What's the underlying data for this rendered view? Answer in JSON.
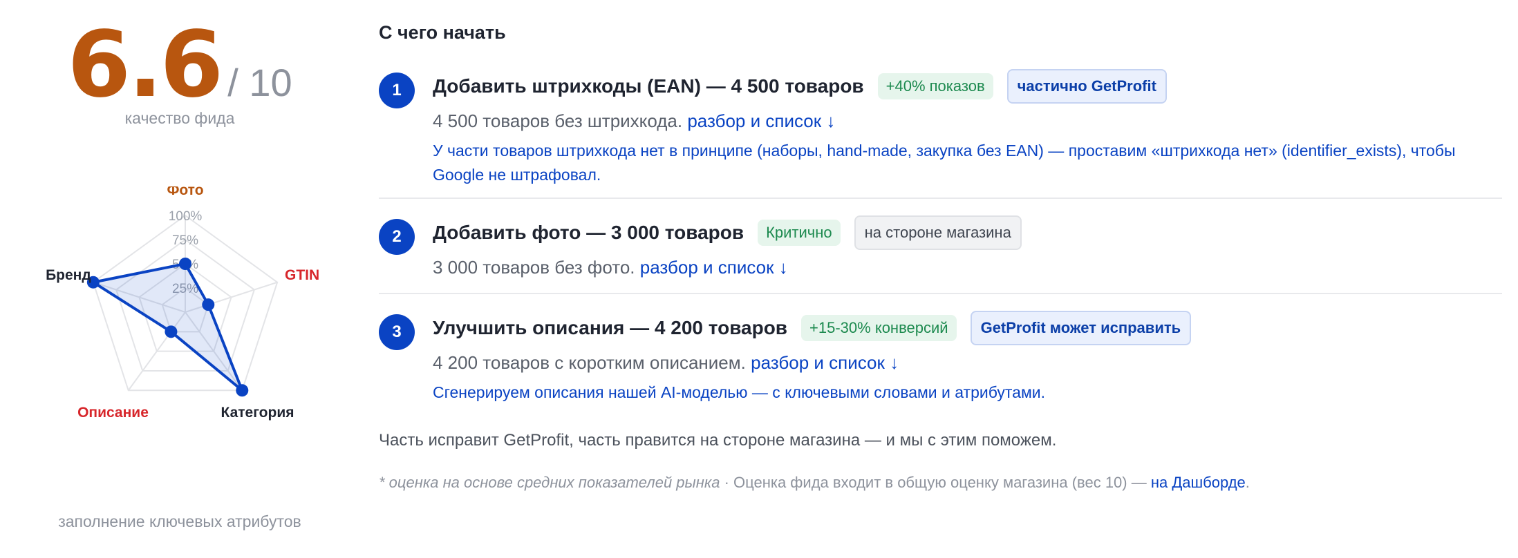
{
  "score": {
    "value": "6.6",
    "max": "/ 10",
    "caption": "качество фида"
  },
  "radar": {
    "axes": [
      {
        "label": "Фото",
        "color": "#b8560f",
        "value": 50
      },
      {
        "label": "GTIN",
        "color": "#d7262b",
        "value": 25
      },
      {
        "label": "Категория",
        "color": "#1f2430",
        "value": 100
      },
      {
        "label": "Описание",
        "color": "#d7262b",
        "value": 25
      },
      {
        "label": "Бренд",
        "color": "#1f2430",
        "value": 100
      }
    ],
    "ring_labels": [
      "25%",
      "50%",
      "75%",
      "100%"
    ],
    "fill_color": "#0a43c3",
    "footer": "заполнение ключевых атрибутов"
  },
  "main": {
    "title": "С чего начать",
    "steps": [
      {
        "num": "1",
        "title": "Добавить штрихкоды (EAN) — 4 500 товаров",
        "tag_impact": "+40% показов",
        "tag_owner": "частично GetProfit",
        "sub": "4 500 товаров без штрихкода.",
        "link": "разбор и список ↓",
        "note": "У части товаров штрихкода нет в принципе (наборы, hand-made, закупка без EAN) — проставим «штрихкода нет» (identifier_exists), чтобы Google не штрафовал."
      },
      {
        "num": "2",
        "title": "Добавить фото — 3 000 товаров",
        "tag_impact": "Критично",
        "tag_owner": "на стороне магазина",
        "sub": "3 000 товаров без фото.",
        "link": "разбор и список ↓"
      },
      {
        "num": "3",
        "title": "Улучшить описания — 4 200 товаров",
        "tag_impact": "+15-30% конверсий",
        "tag_owner": "GetProfit может исправить",
        "sub": "4 200 товаров с коротким описанием.",
        "link": "разбор и список ↓",
        "note": "Сгенерируем описания нашей AI-моделью — с ключевыми словами и атрибутами."
      }
    ],
    "summary": "Часть исправит GetProfit, часть правится на стороне магазина — и мы с этим поможем.",
    "footnote": {
      "italic": "* оценка на основе средних показателей рынка",
      "text": " · Оценка фида входит в общую оценку магазина (вес 10) — ",
      "link": "на Дашборде",
      "end": "."
    }
  }
}
